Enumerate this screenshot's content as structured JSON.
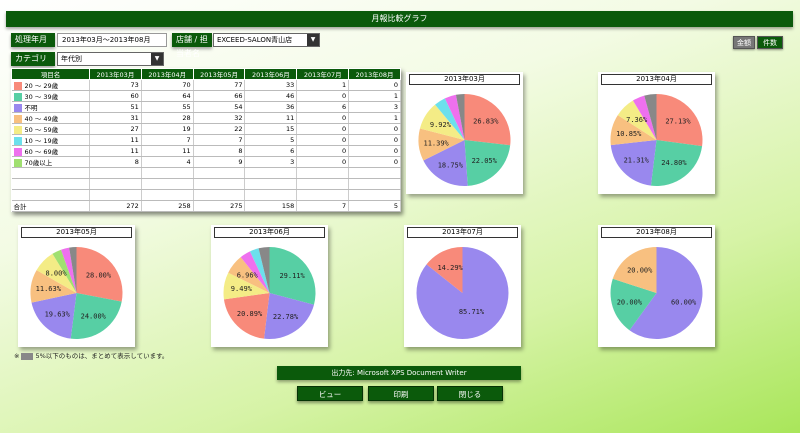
{
  "title": "月報比較グラフ",
  "period": {
    "label": "処理年月",
    "value": "2013年03月～2013年08月"
  },
  "store": {
    "label": "店舗 / 担当者名",
    "value": "EXCEED-SALON青山店"
  },
  "category": {
    "label": "カテゴリ",
    "value": "年代別"
  },
  "toggles": {
    "amount": "金額",
    "count": "件数"
  },
  "table": {
    "headers": [
      "項目名",
      "2013年03月",
      "2013年04月",
      "2013年05月",
      "2013年06月",
      "2013年07月",
      "2013年08月"
    ],
    "rows": [
      {
        "name": "20 ～ 29歳",
        "color": "#f88a7a",
        "values": [
          "73",
          "70",
          "77",
          "33",
          "1",
          "0"
        ]
      },
      {
        "name": "30 ～ 39歳",
        "color": "#57cfa4",
        "values": [
          "60",
          "64",
          "66",
          "46",
          "0",
          "1"
        ]
      },
      {
        "name": "不明",
        "color": "#9988ee",
        "values": [
          "51",
          "55",
          "54",
          "36",
          "6",
          "3"
        ]
      },
      {
        "name": "40 ～ 49歳",
        "color": "#f8c080",
        "values": [
          "31",
          "28",
          "32",
          "11",
          "0",
          "1"
        ]
      },
      {
        "name": "50 ～ 59歳",
        "color": "#f4ec86",
        "values": [
          "27",
          "19",
          "22",
          "15",
          "0",
          "0"
        ]
      },
      {
        "name": "10 ～ 19歳",
        "color": "#6ce0ec",
        "values": [
          "11",
          "7",
          "7",
          "5",
          "0",
          "0"
        ]
      },
      {
        "name": "60 ～ 69歳",
        "color": "#ee70ee",
        "values": [
          "11",
          "11",
          "8",
          "6",
          "0",
          "0"
        ]
      },
      {
        "name": "70歳以上",
        "color": "#a0e070",
        "values": [
          "8",
          "4",
          "9",
          "3",
          "0",
          "0"
        ]
      },
      {
        "name": "",
        "color": "",
        "values": [
          "",
          "",
          "",
          "",
          "",
          ""
        ]
      },
      {
        "name": "",
        "color": "",
        "values": [
          "",
          "",
          "",
          "",
          "",
          ""
        ]
      },
      {
        "name": "",
        "color": "",
        "values": [
          "",
          "",
          "",
          "",
          "",
          ""
        ]
      },
      {
        "name": "合計",
        "color": "",
        "values": [
          "272",
          "258",
          "275",
          "158",
          "7",
          "5"
        ]
      }
    ]
  },
  "chart_data": [
    {
      "type": "pie",
      "title": "2013年03月",
      "slices": [
        {
          "value": 26.83,
          "label": "26.83%",
          "color": "#f88a7a"
        },
        {
          "value": 22.05,
          "label": "22.05%",
          "color": "#57cfa4"
        },
        {
          "value": 18.75,
          "label": "18.75%",
          "color": "#9988ee"
        },
        {
          "value": 11.39,
          "label": "11.39%",
          "color": "#f8c080"
        },
        {
          "value": 9.92,
          "label": "9.92%",
          "color": "#f4ec86"
        },
        {
          "value": 4.04,
          "label": "",
          "color": "#6ce0ec"
        },
        {
          "value": 4.04,
          "label": "",
          "color": "#ee70ee"
        },
        {
          "value": 2.98,
          "label": "",
          "color": "#888888"
        }
      ]
    },
    {
      "type": "pie",
      "title": "2013年04月",
      "slices": [
        {
          "value": 27.13,
          "label": "27.13%",
          "color": "#f88a7a"
        },
        {
          "value": 24.8,
          "label": "24.80%",
          "color": "#57cfa4"
        },
        {
          "value": 21.31,
          "label": "21.31%",
          "color": "#9988ee"
        },
        {
          "value": 10.85,
          "label": "10.85%",
          "color": "#f8c080"
        },
        {
          "value": 7.36,
          "label": "7.36%",
          "color": "#f4ec86"
        },
        {
          "value": 4.26,
          "label": "",
          "color": "#ee70ee"
        },
        {
          "value": 4.29,
          "label": "",
          "color": "#888888"
        }
      ]
    },
    {
      "type": "pie",
      "title": "2013年05月",
      "slices": [
        {
          "value": 28.0,
          "label": "28.00%",
          "color": "#f88a7a"
        },
        {
          "value": 24.0,
          "label": "24.00%",
          "color": "#57cfa4"
        },
        {
          "value": 19.63,
          "label": "19.63%",
          "color": "#9988ee"
        },
        {
          "value": 11.63,
          "label": "11.63%",
          "color": "#f8c080"
        },
        {
          "value": 8.0,
          "label": "8.00%",
          "color": "#f4ec86"
        },
        {
          "value": 3.27,
          "label": "",
          "color": "#a0e070"
        },
        {
          "value": 2.91,
          "label": "",
          "color": "#ee70ee"
        },
        {
          "value": 2.56,
          "label": "",
          "color": "#888888"
        }
      ]
    },
    {
      "type": "pie",
      "title": "2013年06月",
      "slices": [
        {
          "value": 29.11,
          "label": "29.11%",
          "color": "#57cfa4"
        },
        {
          "value": 22.78,
          "label": "22.78%",
          "color": "#9988ee"
        },
        {
          "value": 20.89,
          "label": "20.89%",
          "color": "#f88a7a"
        },
        {
          "value": 9.49,
          "label": "9.49%",
          "color": "#f4ec86"
        },
        {
          "value": 6.96,
          "label": "6.96%",
          "color": "#f8c080"
        },
        {
          "value": 3.8,
          "label": "",
          "color": "#ee70ee"
        },
        {
          "value": 3.16,
          "label": "",
          "color": "#6ce0ec"
        },
        {
          "value": 3.81,
          "label": "",
          "color": "#888888"
        }
      ]
    },
    {
      "type": "pie",
      "title": "2013年07月",
      "slices": [
        {
          "value": 85.71,
          "label": "85.71%",
          "color": "#9988ee"
        },
        {
          "value": 14.29,
          "label": "14.29%",
          "color": "#f88a7a"
        }
      ]
    },
    {
      "type": "pie",
      "title": "2013年08月",
      "slices": [
        {
          "value": 60.0,
          "label": "60.00%",
          "color": "#9988ee"
        },
        {
          "value": 20.0,
          "label": "20.00%",
          "color": "#57cfa4"
        },
        {
          "value": 20.0,
          "label": "20.00%",
          "color": "#f8c080"
        }
      ]
    }
  ],
  "note": {
    "prefix": "※",
    "text": "5%以下のものは、まとめて表示しています。"
  },
  "output": "出力先: Microsoft XPS Document Writer",
  "buttons": {
    "view": "ビュー",
    "print": "印刷",
    "close": "閉じる"
  }
}
